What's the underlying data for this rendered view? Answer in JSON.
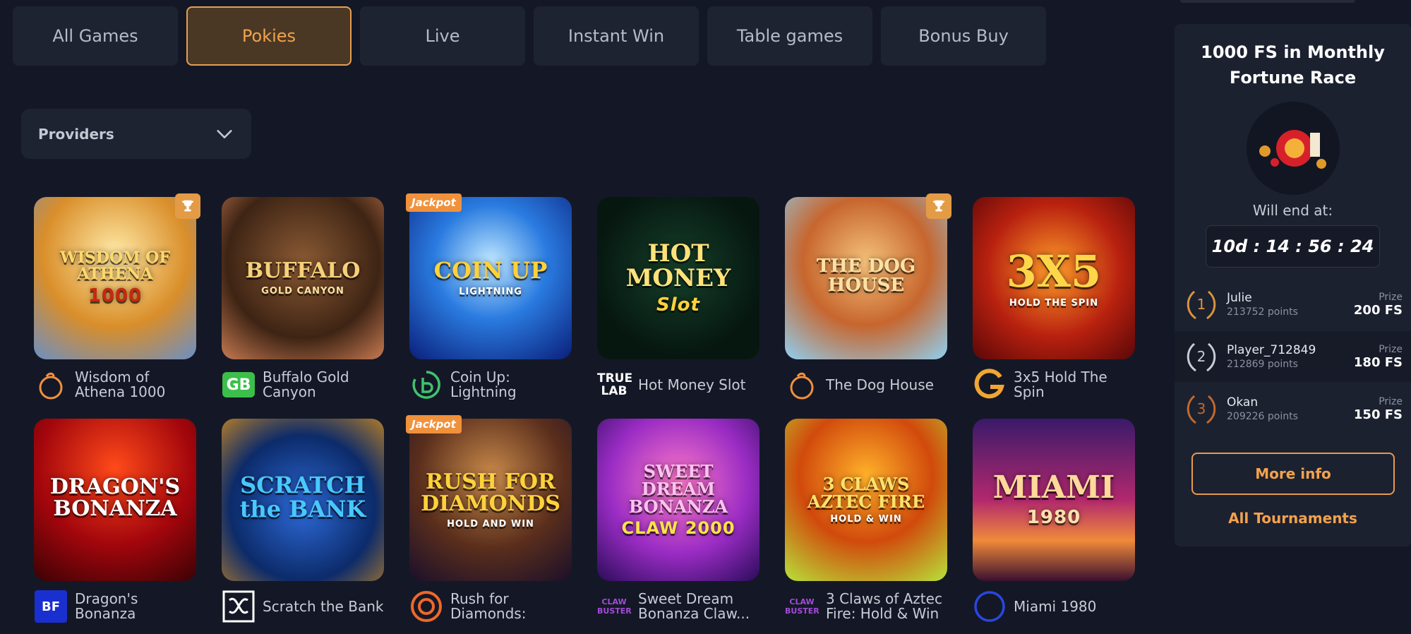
{
  "tabs": [
    {
      "label": "All Games",
      "active": false
    },
    {
      "label": "Pokies",
      "active": true
    },
    {
      "label": "Live",
      "active": false
    },
    {
      "label": "Instant Win",
      "active": false
    },
    {
      "label": "Table games",
      "active": false
    },
    {
      "label": "Bonus Buy",
      "active": false
    }
  ],
  "providers": {
    "label": "Providers"
  },
  "games": [
    {
      "name": "Wisdom of Athena 1000",
      "art_title": "WISDOM OF ATHENA",
      "art_sub": "1000",
      "badge": "trophy",
      "provider_icon": "pragmatic-icon"
    },
    {
      "name": "Buffalo Gold Canyon",
      "art_title": "BUFFALO",
      "art_sub": "GOLD CANYON",
      "badge": "",
      "provider_icon": "gamebeat-icon",
      "provider_text": "GB"
    },
    {
      "name": "Coin Up: Lightning",
      "art_title": "COIN UP",
      "art_sub": "LIGHTNING",
      "badge": "jackpot",
      "badge_text": "Jackpot",
      "provider_icon": "booming-icon"
    },
    {
      "name": "Hot Money Slot",
      "art_title": "HOT MONEY",
      "art_sub": "Slot",
      "badge": "",
      "provider_icon": "truelab-icon",
      "provider_text": "TRUE LAB"
    },
    {
      "name": "The Dog House",
      "art_title": "THE DOG HOUSE",
      "art_sub": "",
      "badge": "trophy",
      "provider_icon": "pragmatic-icon"
    },
    {
      "name": "3x5 Hold The Spin",
      "art_title": "3X5",
      "art_sub": "HOLD THE SPIN",
      "badge": "",
      "provider_icon": "gamzix-icon"
    },
    {
      "name": "Dragon's Bonanza",
      "art_title": "DRAGON'S BONANZA",
      "art_sub": "",
      "badge": "",
      "provider_icon": "bf-games-icon"
    },
    {
      "name": "Scratch the Bank",
      "art_title": "SCRATCH the BANK",
      "art_sub": "",
      "badge": "",
      "provider_icon": "knot-icon"
    },
    {
      "name": "Rush for Diamonds: Hold...",
      "art_title": "RUSH FOR DIAMONDS",
      "art_sub": "HOLD AND WIN",
      "badge": "jackpot",
      "badge_text": "Jackpot",
      "provider_icon": "target-icon"
    },
    {
      "name": "Sweet Dream Bonanza Claw...",
      "art_title": "SWEET DREAM BONANZA",
      "art_sub": "CLAW 2000",
      "badge": "",
      "provider_icon": "clawbuster-icon",
      "provider_text": "CLAW BUSTER"
    },
    {
      "name": "3 Claws of Aztec Fire: Hold & Win",
      "art_title": "3 CLAWS AZTEC FIRE",
      "art_sub": "HOLD & WIN",
      "badge": "",
      "provider_icon": "clawbuster-icon",
      "provider_text": "CLAW BUSTER"
    },
    {
      "name": "Miami 1980",
      "art_title": "MIAMI",
      "art_sub": "1980",
      "badge": "",
      "provider_icon": "ring-icon"
    }
  ],
  "tournament": {
    "title": "1000 FS in Monthly Fortune Race",
    "end_label": "Will end at:",
    "timer": "10d : 14 : 56 : 24",
    "prize_label": "Prize",
    "leaders": [
      {
        "rank": "1",
        "name": "Julie",
        "points": "213752 points",
        "prize": "200 FS"
      },
      {
        "rank": "2",
        "name": "Player_712849",
        "points": "212869 points",
        "prize": "180 FS"
      },
      {
        "rank": "3",
        "name": "Okan",
        "points": "209226 points",
        "prize": "150 FS"
      }
    ],
    "more_info": "More info",
    "all_tournaments": "All Tournaments"
  },
  "colors": {
    "accent": "#f3a24d",
    "background": "#141826",
    "panel": "#1c2130"
  }
}
